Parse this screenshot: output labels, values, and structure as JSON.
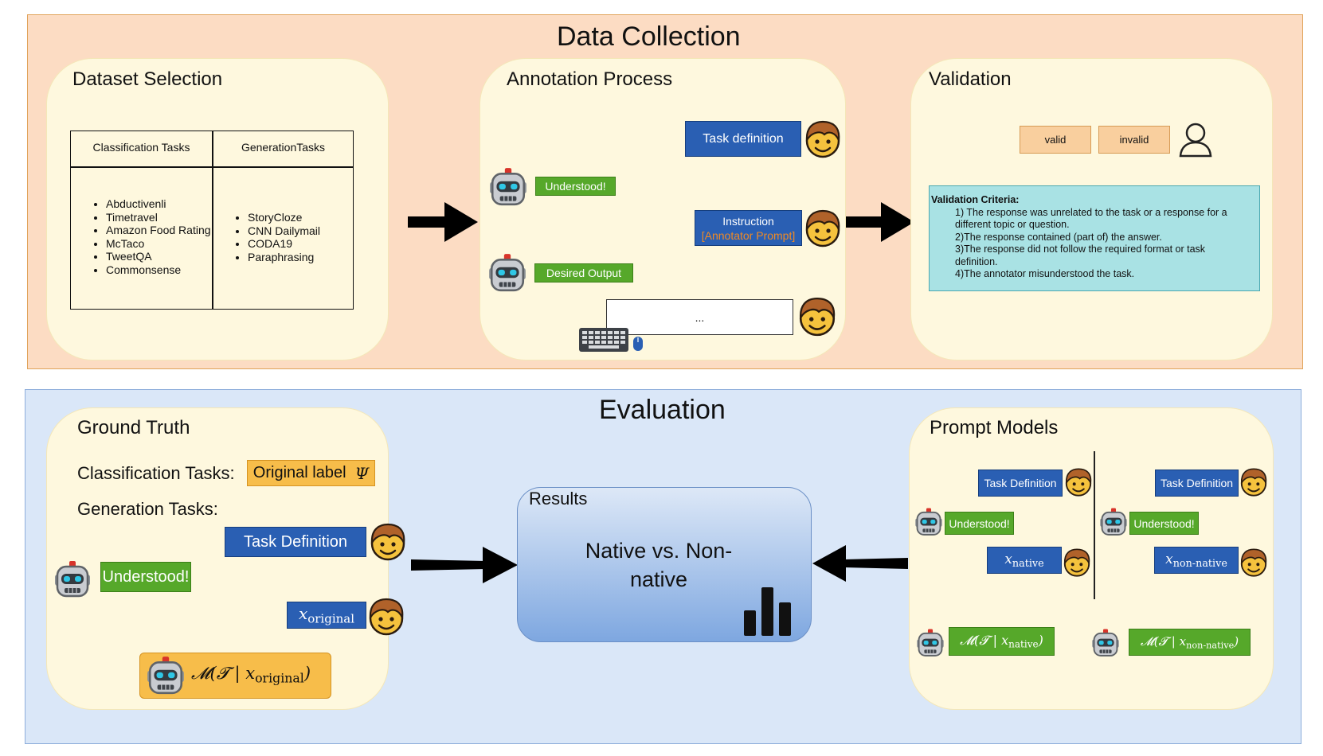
{
  "data_collection": {
    "title": "Data Collection",
    "dataset_selection": {
      "title": "Dataset Selection",
      "col1_header": "Classification Tasks",
      "col2_header": "GenerationTasks",
      "classification_tasks": [
        "Abductivenli",
        "Timetravel",
        "Amazon Food Rating",
        "McTaco",
        "TweetQA",
        "Commonsense"
      ],
      "generation_tasks": [
        "StoryCloze",
        "CNN Dailymail",
        "CODA19",
        "Paraphrasing"
      ]
    },
    "annotation_process": {
      "title": "Annotation Process",
      "task_definition": "Task definition",
      "understood": "Understood!",
      "instruction": "Instruction",
      "annotator_prompt": "[Annotator Prompt]",
      "desired_output": "Desired Output",
      "input_placeholder": "..."
    },
    "validation": {
      "title": "Validation",
      "valid": "valid",
      "invalid": "invalid",
      "criteria_title": "Validation Criteria:",
      "criteria": [
        "1) The response was unrelated to the task or a response for a different topic or question.",
        "2)The response contained (part of) the answer.",
        "3)The response did not follow the required format or task definition.",
        "4)The annotator misunderstood the task."
      ]
    }
  },
  "evaluation": {
    "title": "Evaluation",
    "ground_truth": {
      "title": "Ground Truth",
      "classification_label": "Classification Tasks:",
      "original_label": "Original label",
      "psi": "Ψ",
      "generation_label": "Generation Tasks:",
      "task_definition": "Task Definition",
      "understood": "Understood!",
      "x_var": "x",
      "x_sub": "original",
      "model_output": "𝓜(𝓣 | x",
      "model_output_sub": "original",
      "model_output_close": ")"
    },
    "results": {
      "title": "Results",
      "text": "Native vs. Non-native"
    },
    "prompt_models": {
      "title": "Prompt Models",
      "task_definition": "Task Definition",
      "understood": "Understood!",
      "x_var": "x",
      "native_sub": "native",
      "non_native_sub": "non-native",
      "model_prefix": "𝓜(𝓣 | x",
      "model_close": ")"
    }
  },
  "colors": {
    "data_collection_bg": "#fcdcc3",
    "evaluation_bg": "#dae7f8",
    "panel_bg": "#fef8de",
    "blue_box": "#2a5fb3",
    "green_box": "#56a82a",
    "orange_box": "#f7bd4a",
    "criteria_bg": "#a9e2e4"
  },
  "icons": [
    "robot-icon",
    "person-face-icon",
    "user-outline-icon",
    "keyboard-icon",
    "mouse-icon",
    "bar-chart-icon",
    "arrow-right-icon",
    "arrow-left-icon"
  ]
}
